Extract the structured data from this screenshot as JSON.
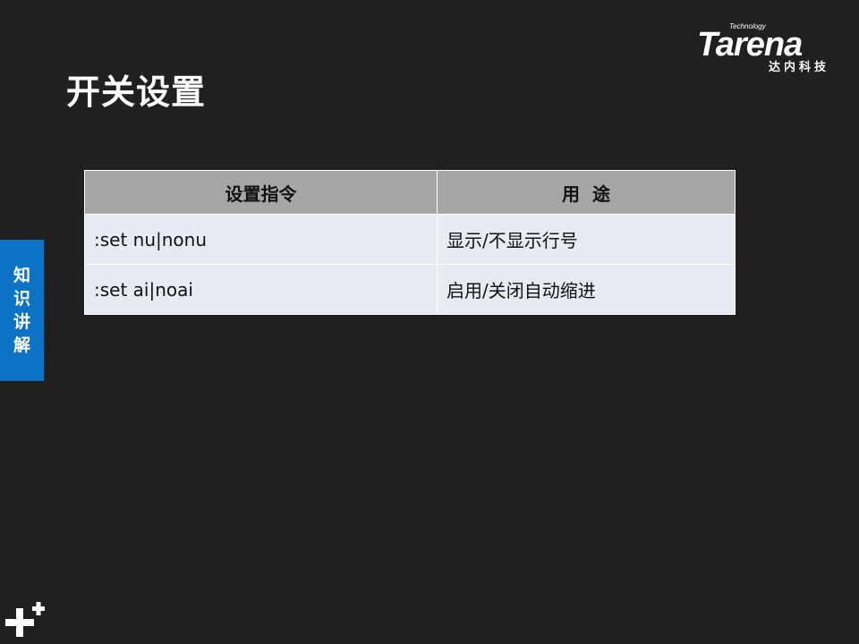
{
  "slide": {
    "title": "开关设置",
    "side_tab": [
      "知",
      "识",
      "讲",
      "解"
    ]
  },
  "logo": {
    "technology": "Technology",
    "brand": "Tarena",
    "chinese": "达内科技"
  },
  "table": {
    "headers": [
      "设置指令",
      "用  途"
    ],
    "rows": [
      {
        "command": ":set nu|nonu",
        "purpose": "显示/不显示行号"
      },
      {
        "command": ":set ai|noai",
        "purpose": "启用/关闭自动缩进"
      }
    ]
  }
}
